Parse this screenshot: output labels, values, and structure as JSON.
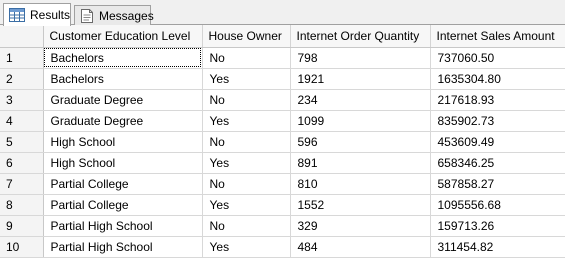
{
  "tabs": [
    {
      "label": "Results",
      "icon": "results-grid-icon",
      "active": true
    },
    {
      "label": "Messages",
      "icon": "messages-icon",
      "active": false
    }
  ],
  "grid": {
    "columns": [
      "Customer Education Level",
      "House Owner",
      "Internet Order Quantity",
      "Internet Sales Amount"
    ],
    "rows": [
      {
        "num": "1",
        "cells": [
          "Bachelors",
          "No",
          "798",
          "737060.50"
        ]
      },
      {
        "num": "2",
        "cells": [
          "Bachelors",
          "Yes",
          "1921",
          "1635304.80"
        ]
      },
      {
        "num": "3",
        "cells": [
          "Graduate Degree",
          "No",
          "234",
          "217618.93"
        ]
      },
      {
        "num": "4",
        "cells": [
          "Graduate Degree",
          "Yes",
          "1099",
          "835902.73"
        ]
      },
      {
        "num": "5",
        "cells": [
          "High School",
          "No",
          "596",
          "453609.49"
        ]
      },
      {
        "num": "6",
        "cells": [
          "High School",
          "Yes",
          "891",
          "658346.25"
        ]
      },
      {
        "num": "7",
        "cells": [
          "Partial College",
          "No",
          "810",
          "587858.27"
        ]
      },
      {
        "num": "8",
        "cells": [
          "Partial College",
          "Yes",
          "1552",
          "1095556.68"
        ]
      },
      {
        "num": "9",
        "cells": [
          "Partial High School",
          "No",
          "329",
          "159713.26"
        ]
      },
      {
        "num": "10",
        "cells": [
          "Partial High School",
          "Yes",
          "484",
          "311454.82"
        ]
      }
    ]
  },
  "colors": {
    "header_bg": "#f7f7f7",
    "gridline": "#d8d8d8",
    "tab_strip": "#f0f0f0"
  }
}
